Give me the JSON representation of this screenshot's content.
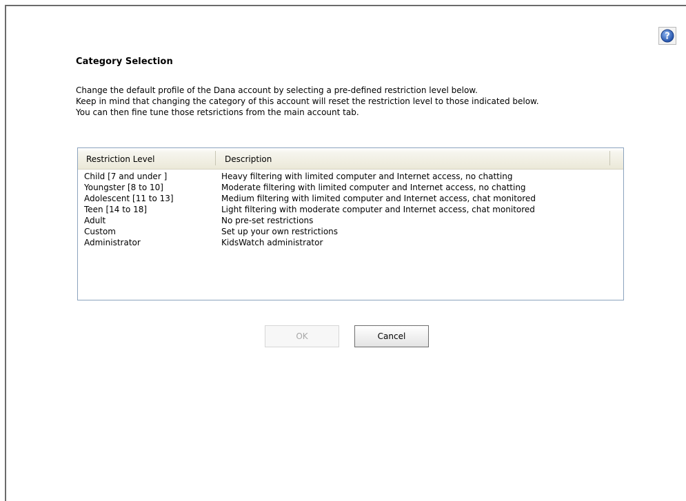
{
  "dialog": {
    "title": "Category Selection",
    "intro": [
      "Change the default profile of the Dana account by selecting a pre-defined restriction level below.",
      "Keep in mind that changing the category of this account will reset the restriction level to those indicated below.",
      "You can then fine tune those retsrictions from the main account tab."
    ]
  },
  "help": {
    "icon": "help-icon"
  },
  "table": {
    "headers": [
      "Restriction Level",
      "Description"
    ],
    "rows": [
      {
        "level": "Child [7 and under ]",
        "description": "Heavy filtering with limited computer and Internet access, no chatting"
      },
      {
        "level": "Youngster [8 to 10]",
        "description": "Moderate filtering with limited computer and Internet access, no chatting"
      },
      {
        "level": "Adolescent [11 to 13]",
        "description": "Medium filtering with limited computer and Internet access, chat monitored"
      },
      {
        "level": "Teen [14 to 18]",
        "description": "Light filtering with moderate computer and Internet access, chat monitored"
      },
      {
        "level": "Adult",
        "description": "No pre-set restrictions"
      },
      {
        "level": "Custom",
        "description": "Set up your own restrictions"
      },
      {
        "level": "Administrator",
        "description": "KidsWatch administrator"
      }
    ]
  },
  "buttons": {
    "ok_label": "OK",
    "cancel_label": "Cancel"
  },
  "colors": {
    "help_blue": "#2f5fb3",
    "border_blue": "#8aa2bd"
  }
}
